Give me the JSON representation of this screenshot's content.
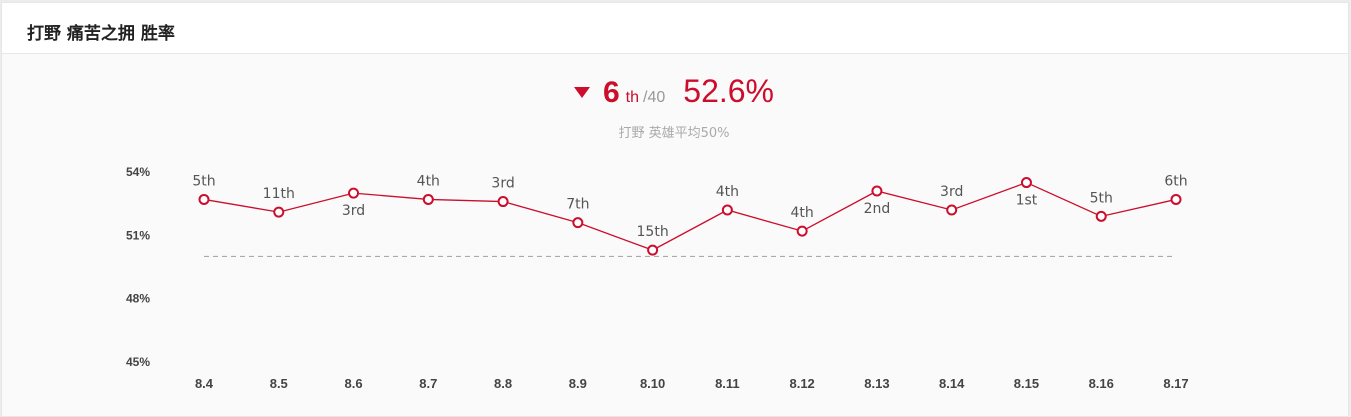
{
  "header": {
    "title": "打野 痛苦之拥 胜率"
  },
  "summary": {
    "rank": "6",
    "rank_suffix": "th",
    "rank_total": "/40",
    "win_rate": "52.6%",
    "trend": "down",
    "subtitle": "打野 英雄平均50%"
  },
  "colors": {
    "accent": "#cc0d2c",
    "average_line": "#aaaaaa"
  },
  "chart_data": {
    "type": "line",
    "categories": [
      "8.4",
      "8.5",
      "8.6",
      "8.7",
      "8.8",
      "8.9",
      "8.10",
      "8.11",
      "8.12",
      "8.13",
      "8.14",
      "8.15",
      "8.16",
      "8.17"
    ],
    "values": [
      52.7,
      52.1,
      53.0,
      52.7,
      52.6,
      51.6,
      50.3,
      52.2,
      51.2,
      53.1,
      52.2,
      53.5,
      51.9,
      52.7
    ],
    "ranks": [
      "5th",
      "11th",
      "3rd",
      "4th",
      "3rd",
      "7th",
      "15th",
      "4th",
      "4th",
      "2nd",
      "3rd",
      "1st",
      "5th",
      "6th"
    ],
    "label_positions": [
      "above",
      "above",
      "below",
      "above",
      "above",
      "above",
      "above",
      "above",
      "above",
      "below",
      "above",
      "below",
      "above",
      "above"
    ],
    "yticks": [
      "54%",
      "51%",
      "48%",
      "45%"
    ],
    "ylim": [
      45,
      54
    ],
    "average": 50,
    "grid": false
  }
}
